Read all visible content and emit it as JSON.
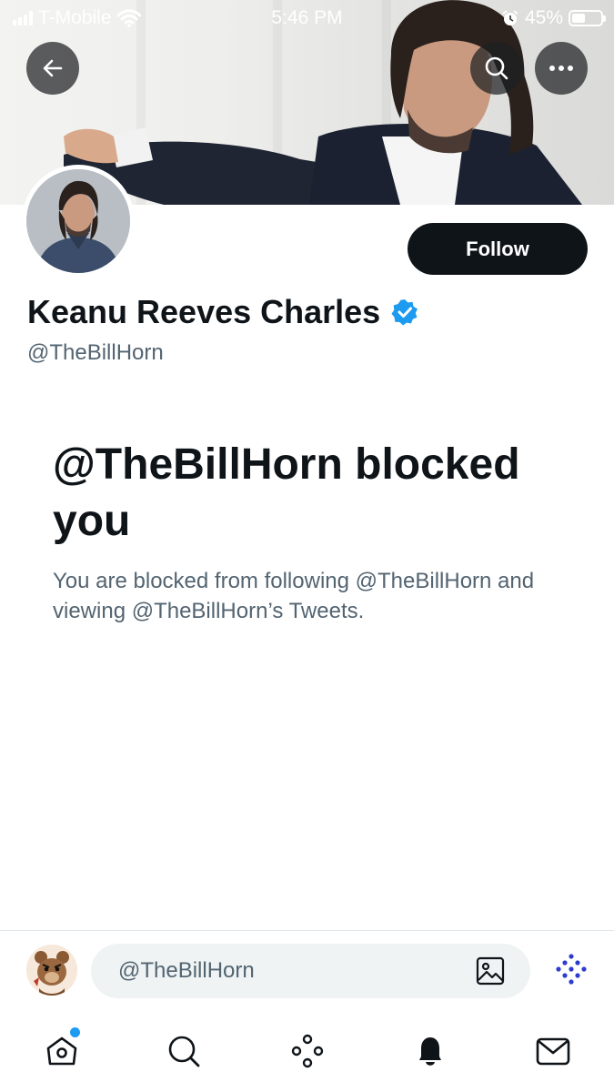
{
  "status_bar": {
    "carrier": "T-Mobile",
    "time": "5:46 PM",
    "battery_label": "45%",
    "battery_level": 0.45,
    "icons": [
      "signal-icon",
      "wifi-icon",
      "alarm-icon",
      "battery-icon"
    ]
  },
  "header": {
    "icons": [
      "back-arrow-icon",
      "search-icon",
      "more-icon"
    ]
  },
  "profile": {
    "display_name": "Keanu Reeves Charles",
    "handle": "@TheBillHorn",
    "verified": true,
    "follow_label": "Follow"
  },
  "blocked": {
    "title": "@TheBillHorn blocked you",
    "message": "You are blocked from following @TheBillHorn and viewing @TheBillHorn’s Tweets."
  },
  "reply_bar": {
    "placeholder": "@TheBillHorn",
    "icons": [
      "image-icon",
      "sparkle-dots-icon"
    ]
  },
  "tab_bar": {
    "items": [
      "home-icon",
      "search-icon",
      "spaces-icon",
      "notifications-icon",
      "messages-icon"
    ],
    "home_has_new": true
  },
  "colors": {
    "accent": "#1d9bf0",
    "text_primary": "#0f1419",
    "text_secondary": "#536471",
    "button_dark": "#0f1419",
    "compose_bg": "#eff3f4",
    "divider": "#e1e6ea"
  }
}
